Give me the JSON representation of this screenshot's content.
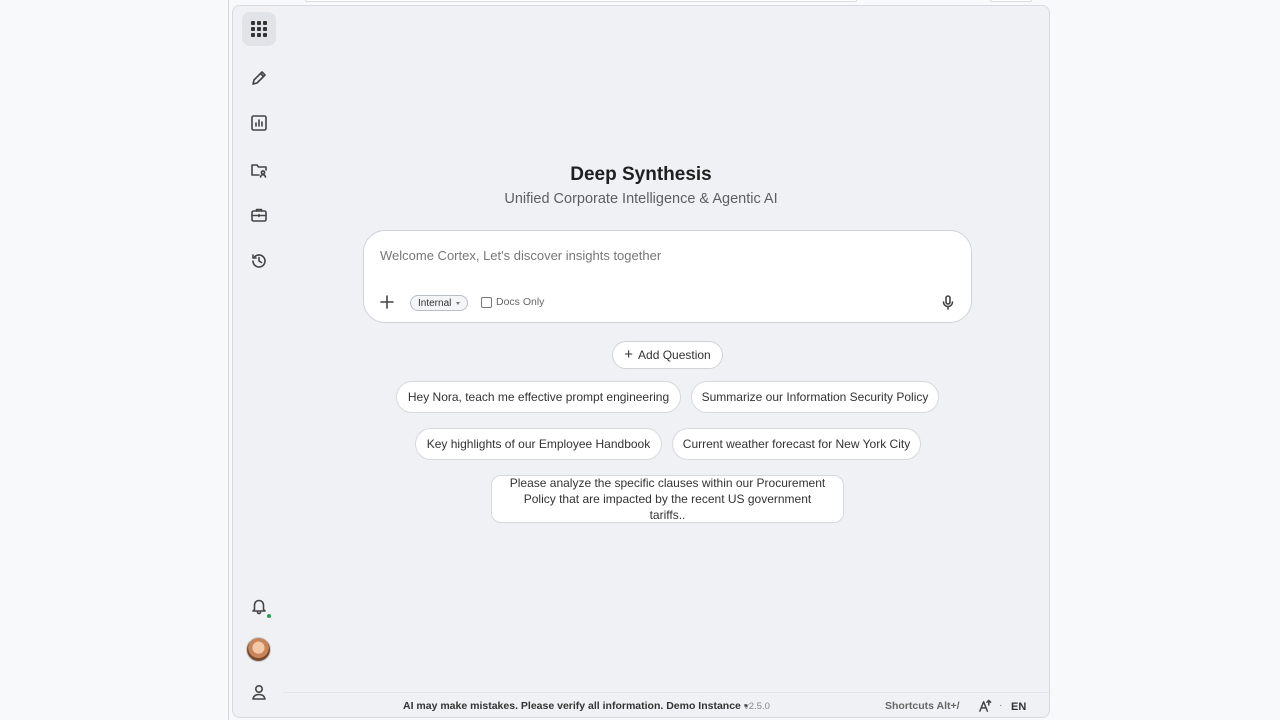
{
  "hero": {
    "title": "Deep Synthesis",
    "subtitle": "Unified Corporate Intelligence & Agentic AI"
  },
  "composer": {
    "placeholder": "Welcome Cortex, Let's discover insights together",
    "mode_chip": "Internal",
    "docs_only_label": "Docs Only",
    "docs_only_checked": false
  },
  "actions": {
    "add_question": "Add Question"
  },
  "suggestions": [
    "Hey Nora, teach me effective prompt engineering",
    "Summarize our Information Security Policy",
    "Key highlights of our Employee Handbook",
    "Current weather forecast for New York City",
    "Please analyze the specific clauses within our Procurement Policy that are impacted by the recent US government tariffs.."
  ],
  "footer": {
    "disclaimer": "AI may make mistakes. Please verify all information. Demo Instance •",
    "version": "v2.5.0",
    "shortcuts": "Shortcuts Alt+/",
    "separator": "·",
    "language": "EN"
  },
  "icons": {
    "apps": "grid-icon",
    "compose": "pencil-icon",
    "analytics": "bar-chart-icon",
    "files": "folder-user-icon",
    "tools": "briefcase-icon",
    "history": "history-icon",
    "notifications": "bell-icon",
    "account": "user-icon"
  },
  "colors": {
    "notification_dot": "#22a04b",
    "frame_bg": "#eff1f4"
  }
}
